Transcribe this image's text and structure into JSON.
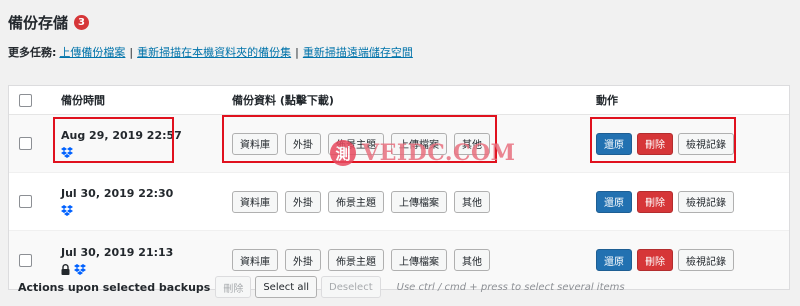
{
  "header": {
    "title": "備份存儲",
    "badge": "3"
  },
  "more_tasks": {
    "label": "更多任務:",
    "links": [
      "上傳備份檔案",
      "重新掃描在本機資料夾的備份集",
      "重新掃描遠端儲存空間"
    ],
    "separator": "|"
  },
  "table": {
    "headers": {
      "time": "備份時間",
      "data": "備份資料 (點擊下載)",
      "actions": "動作"
    },
    "rows": [
      {
        "time": "Aug 29, 2019 22:57",
        "locked": false
      },
      {
        "time": "Jul 30, 2019 22:30",
        "locked": false
      },
      {
        "time": "Jul 30, 2019 21:13",
        "locked": true
      }
    ],
    "data_buttons": [
      "資料庫",
      "外掛",
      "佈景主題",
      "上傳檔案",
      "其他"
    ],
    "action_buttons": {
      "restore": "還原",
      "delete": "刪除",
      "view_log": "檢視記錄"
    }
  },
  "footer": {
    "label": "Actions upon selected backups",
    "delete": "刪除",
    "select_all": "Select all",
    "deselect": "Deselect",
    "hint": "Use ctrl / cmd + press to select several items"
  },
  "watermark": {
    "logo_char": "測",
    "text": "VEIDC.COM"
  },
  "colors": {
    "link": "#0073aa",
    "badge": "#d63638",
    "restore": "#2271b1",
    "delete": "#d63638",
    "highlight": "#e0111e"
  },
  "icons": [
    "dropbox-icon",
    "lock-icon"
  ]
}
